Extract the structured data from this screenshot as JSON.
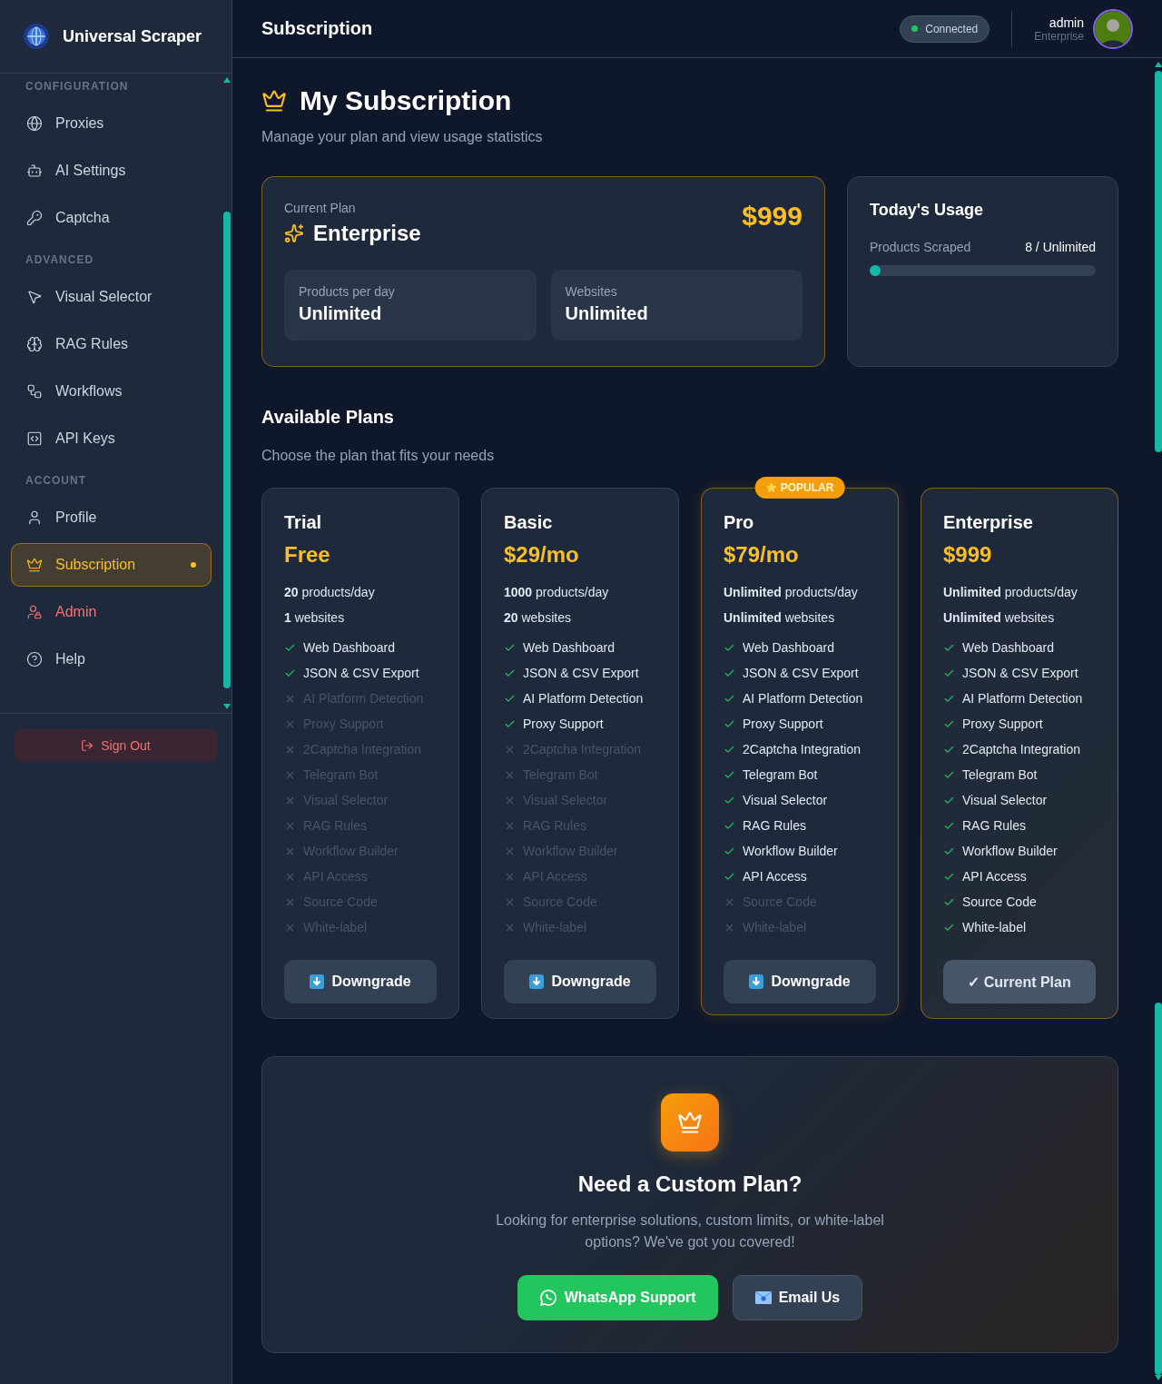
{
  "brand": {
    "name": "Universal Scraper"
  },
  "sidebar": {
    "sections": [
      {
        "label": "CONFIGURATION",
        "items": [
          {
            "label": "Proxies",
            "selected": false,
            "kind": "normal"
          },
          {
            "label": "AI Settings",
            "selected": false,
            "kind": "normal"
          },
          {
            "label": "Captcha",
            "selected": false,
            "kind": "normal"
          }
        ]
      },
      {
        "label": "ADVANCED",
        "items": [
          {
            "label": "Visual Selector",
            "selected": false,
            "kind": "normal"
          },
          {
            "label": "RAG Rules",
            "selected": false,
            "kind": "normal"
          },
          {
            "label": "Workflows",
            "selected": false,
            "kind": "normal"
          },
          {
            "label": "API Keys",
            "selected": false,
            "kind": "normal"
          }
        ]
      },
      {
        "label": "ACCOUNT",
        "items": [
          {
            "label": "Profile",
            "selected": false,
            "kind": "normal"
          },
          {
            "label": "Subscription",
            "selected": true,
            "kind": "normal"
          },
          {
            "label": "Admin",
            "selected": false,
            "kind": "danger"
          },
          {
            "label": "Help",
            "selected": false,
            "kind": "normal"
          }
        ]
      }
    ],
    "sign_out": "Sign Out"
  },
  "header": {
    "title": "Subscription",
    "status": {
      "label": "Connected",
      "color": "#22c55e"
    },
    "user": {
      "name": "admin",
      "plan": "Enterprise"
    }
  },
  "page": {
    "title": "My Subscription",
    "subtitle": "Manage your plan and view usage statistics"
  },
  "current_plan": {
    "label": "Current Plan",
    "name": "Enterprise",
    "price": "$999",
    "stats": [
      {
        "label": "Products per day",
        "value": "Unlimited"
      },
      {
        "label": "Websites",
        "value": "Unlimited"
      }
    ]
  },
  "usage": {
    "title": "Today's Usage",
    "label": "Products Scraped",
    "reading": "8 / Unlimited",
    "level": 0.01
  },
  "plans_section": {
    "title": "Available Plans",
    "subtitle": "Choose the plan that fits your needs"
  },
  "plans": [
    {
      "name": "Trial",
      "price": "Free",
      "popular": false,
      "limits": [
        "**20** products/day",
        "**1** websites"
      ],
      "action": {
        "label": "Downgrade",
        "kind": "downgrade"
      },
      "features": [
        {
          "label": "Web Dashboard",
          "included": true
        },
        {
          "label": "JSON & CSV Export",
          "included": true
        },
        {
          "label": "AI Platform Detection",
          "included": false
        },
        {
          "label": "Proxy Support",
          "included": false
        },
        {
          "label": "2Captcha Integration",
          "included": false
        },
        {
          "label": "Telegram Bot",
          "included": false
        },
        {
          "label": "Visual Selector",
          "included": false
        },
        {
          "label": "RAG Rules",
          "included": false
        },
        {
          "label": "Workflow Builder",
          "included": false
        },
        {
          "label": "API Access",
          "included": false
        },
        {
          "label": "Source Code",
          "included": false
        },
        {
          "label": "White-label",
          "included": false
        }
      ]
    },
    {
      "name": "Basic",
      "price": "$29/mo",
      "popular": false,
      "limits": [
        "**1000** products/day",
        "**20** websites"
      ],
      "action": {
        "label": "Downgrade",
        "kind": "downgrade"
      },
      "features": [
        {
          "label": "Web Dashboard",
          "included": true
        },
        {
          "label": "JSON & CSV Export",
          "included": true
        },
        {
          "label": "AI Platform Detection",
          "included": true
        },
        {
          "label": "Proxy Support",
          "included": true
        },
        {
          "label": "2Captcha Integration",
          "included": false
        },
        {
          "label": "Telegram Bot",
          "included": false
        },
        {
          "label": "Visual Selector",
          "included": false
        },
        {
          "label": "RAG Rules",
          "included": false
        },
        {
          "label": "Workflow Builder",
          "included": false
        },
        {
          "label": "API Access",
          "included": false
        },
        {
          "label": "Source Code",
          "included": false
        },
        {
          "label": "White-label",
          "included": false
        }
      ]
    },
    {
      "name": "Pro",
      "price": "$79/mo",
      "popular": true,
      "badge": "POPULAR",
      "limits": [
        "**Unlimited** products/day",
        "**Unlimited** websites"
      ],
      "action": {
        "label": "Downgrade",
        "kind": "downgrade"
      },
      "features": [
        {
          "label": "Web Dashboard",
          "included": true
        },
        {
          "label": "JSON & CSV Export",
          "included": true
        },
        {
          "label": "AI Platform Detection",
          "included": true
        },
        {
          "label": "Proxy Support",
          "included": true
        },
        {
          "label": "2Captcha Integration",
          "included": true
        },
        {
          "label": "Telegram Bot",
          "included": true
        },
        {
          "label": "Visual Selector",
          "included": true
        },
        {
          "label": "RAG Rules",
          "included": true
        },
        {
          "label": "Workflow Builder",
          "included": true
        },
        {
          "label": "API Access",
          "included": true
        },
        {
          "label": "Source Code",
          "included": false
        },
        {
          "label": "White-label",
          "included": false
        }
      ]
    },
    {
      "name": "Enterprise",
      "price": "$999",
      "popular": false,
      "limits": [
        "**Unlimited** products/day",
        "**Unlimited** websites"
      ],
      "action": {
        "label": "✓ Current Plan",
        "kind": "current"
      },
      "features": [
        {
          "label": "Web Dashboard",
          "included": true
        },
        {
          "label": "JSON & CSV Export",
          "included": true
        },
        {
          "label": "AI Platform Detection",
          "included": true
        },
        {
          "label": "Proxy Support",
          "included": true
        },
        {
          "label": "2Captcha Integration",
          "included": true
        },
        {
          "label": "Telegram Bot",
          "included": true
        },
        {
          "label": "Visual Selector",
          "included": true
        },
        {
          "label": "RAG Rules",
          "included": true
        },
        {
          "label": "Workflow Builder",
          "included": true
        },
        {
          "label": "API Access",
          "included": true
        },
        {
          "label": "Source Code",
          "included": true
        },
        {
          "label": "White-label",
          "included": true
        }
      ]
    }
  ],
  "custom": {
    "title": "Need a Custom Plan?",
    "text": "Looking for enterprise solutions, custom limits, or white-label options? We've got you covered!",
    "buttons": [
      {
        "label": "WhatsApp Support",
        "kind": "whatsapp"
      },
      {
        "label": "Email Us",
        "kind": "email"
      }
    ]
  }
}
